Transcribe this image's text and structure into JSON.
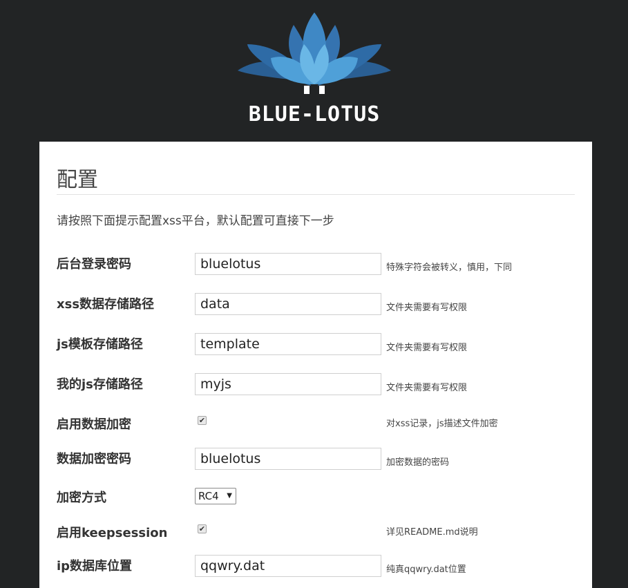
{
  "header": {
    "logo_text": "BLUE-LOTUS",
    "colors": {
      "dark_petal": "#2a5f94",
      "mid_petal": "#3f88c5",
      "light_petal": "#6ab7e6",
      "background": "#222425"
    }
  },
  "page": {
    "title": "配置",
    "intro": "请按照下面提示配置xss平台，默认配置可直接下一步"
  },
  "fields": [
    {
      "label": "后台登录密码",
      "type": "text",
      "value": "bluelotus",
      "hint": "特殊字符会被转义，慎用，下同"
    },
    {
      "label": "xss数据存储路径",
      "type": "text",
      "value": "data",
      "hint": "文件夹需要有写权限"
    },
    {
      "label": "js模板存储路径",
      "type": "text",
      "value": "template",
      "hint": "文件夹需要有写权限"
    },
    {
      "label": "我的js存储路径",
      "type": "text",
      "value": "myjs",
      "hint": "文件夹需要有写权限"
    },
    {
      "label": "启用数据加密",
      "type": "checkbox",
      "checked": true,
      "hint": "对xss记录，js描述文件加密"
    },
    {
      "label": "数据加密密码",
      "type": "text",
      "value": "bluelotus",
      "hint": "加密数据的密码"
    },
    {
      "label": "加密方式",
      "type": "select",
      "value": "RC4",
      "hint": ""
    },
    {
      "label": "启用keepsession",
      "type": "checkbox",
      "checked": true,
      "hint": "详见README.md说明"
    },
    {
      "label": "ip数据库位置",
      "type": "text",
      "value": "qqwry.dat",
      "hint": "纯真qqwry.dat位置"
    }
  ]
}
